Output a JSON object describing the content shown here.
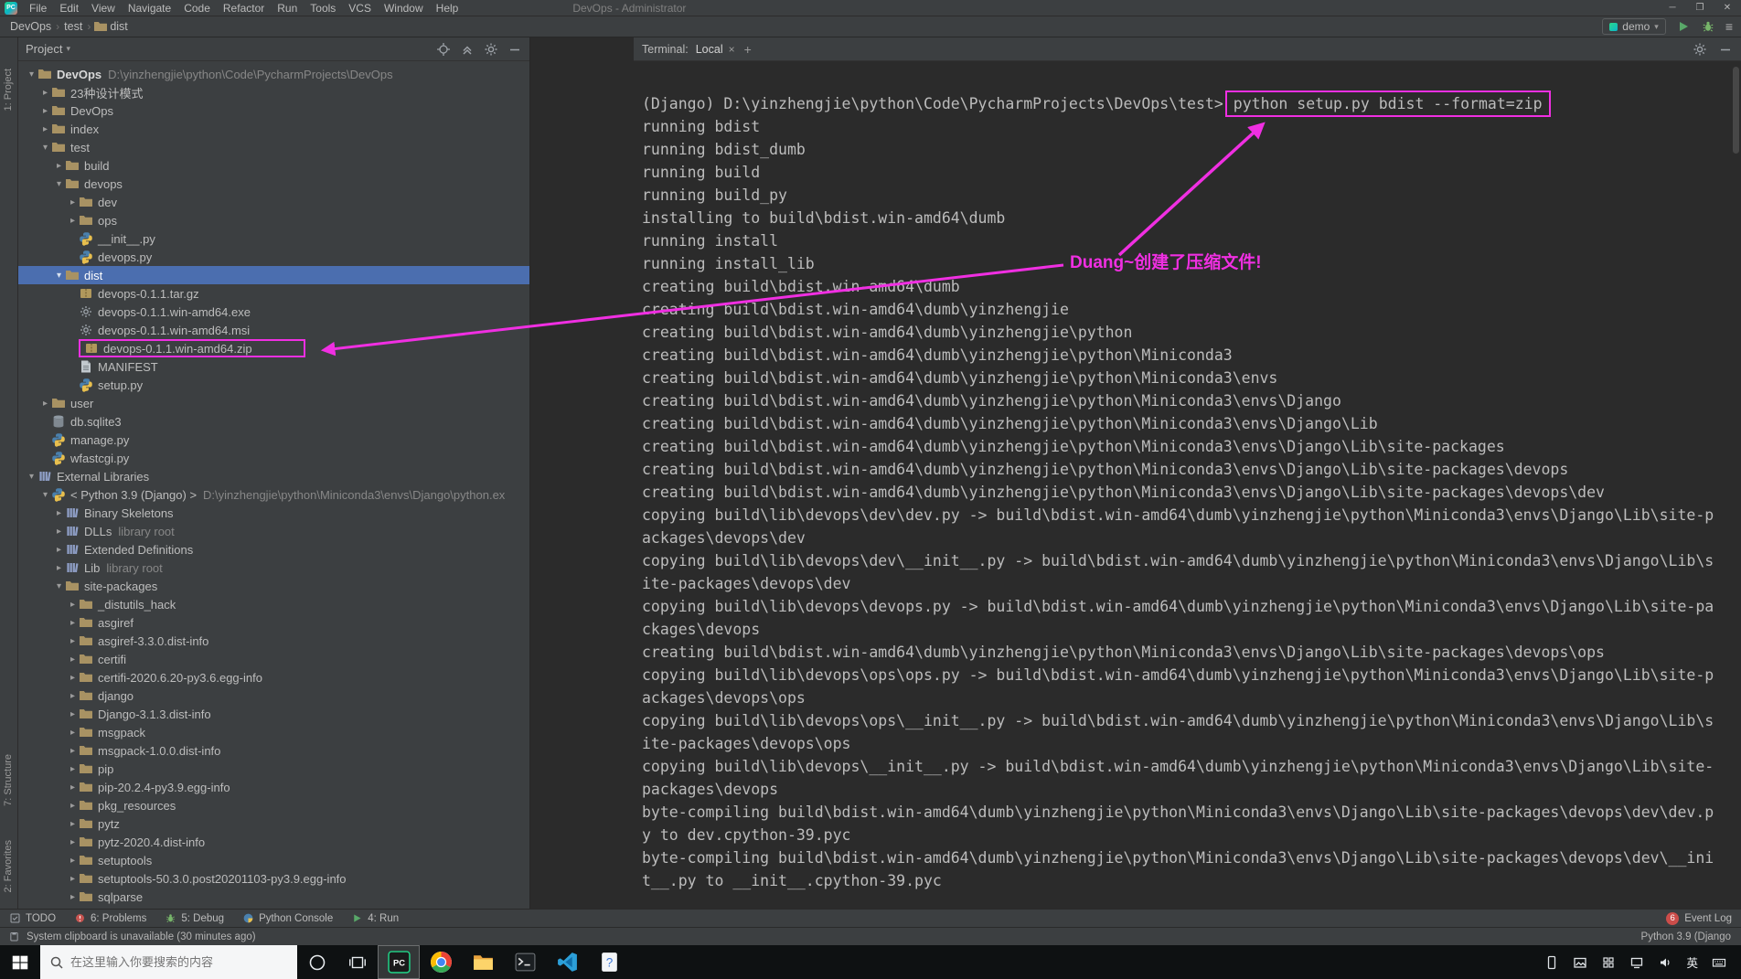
{
  "icons_text": {
    "dropdown": "▾",
    "chevron_open": "▾",
    "chevron_closed": "▸",
    "breadcrumb_sep": "›",
    "tab_close": "×",
    "tab_new": "+",
    "minimize": "─",
    "maximize": "❐",
    "close": "✕",
    "hamburger": "≡",
    "logo_text": "PC"
  },
  "titlebar": {
    "menus": [
      "File",
      "Edit",
      "View",
      "Navigate",
      "Code",
      "Refactor",
      "Run",
      "Tools",
      "VCS",
      "Window",
      "Help"
    ],
    "title": "DevOps - Administrator"
  },
  "navbar": {
    "breadcrumbs": [
      "DevOps",
      "test",
      "dist"
    ],
    "run_config": "demo"
  },
  "tool_strips": {
    "project": "1: Project",
    "structure": "7: Structure",
    "favorites": "2: Favorites"
  },
  "project_panel": {
    "title": "Project",
    "tree": [
      {
        "ind": 0,
        "ch": "v",
        "ic": "folder",
        "lb": "DevOps",
        "sub": "D:\\yinzhengjie\\python\\Code\\PycharmProjects\\DevOps",
        "bold": true
      },
      {
        "ind": 1,
        "ch": ">",
        "ic": "folder",
        "lb": "23种设计模式"
      },
      {
        "ind": 1,
        "ch": ">",
        "ic": "folder",
        "lb": "DevOps"
      },
      {
        "ind": 1,
        "ch": ">",
        "ic": "folder",
        "lb": "index"
      },
      {
        "ind": 1,
        "ch": "v",
        "ic": "folder",
        "lb": "test"
      },
      {
        "ind": 2,
        "ch": ">",
        "ic": "folder",
        "lb": "build"
      },
      {
        "ind": 2,
        "ch": "v",
        "ic": "folder",
        "lb": "devops"
      },
      {
        "ind": 3,
        "ch": ">",
        "ic": "folder",
        "lb": "dev"
      },
      {
        "ind": 3,
        "ch": ">",
        "ic": "folder",
        "lb": "ops"
      },
      {
        "ind": 3,
        "ch": "",
        "ic": "python",
        "lb": "__init__.py"
      },
      {
        "ind": 3,
        "ch": "",
        "ic": "python",
        "lb": "devops.py"
      },
      {
        "ind": 2,
        "ch": "v",
        "ic": "folder",
        "lb": "dist",
        "sel": true
      },
      {
        "ind": 3,
        "ch": "",
        "ic": "archive",
        "lb": "devops-0.1.1.tar.gz"
      },
      {
        "ind": 3,
        "ch": "",
        "ic": "binary",
        "lb": "devops-0.1.1.win-amd64.exe"
      },
      {
        "ind": 3,
        "ch": "",
        "ic": "binary",
        "lb": "devops-0.1.1.win-amd64.msi"
      },
      {
        "ind": 3,
        "ch": "",
        "ic": "archive",
        "lb": "devops-0.1.1.win-amd64.zip",
        "box": true
      },
      {
        "ind": 3,
        "ch": "",
        "ic": "file",
        "lb": "MANIFEST"
      },
      {
        "ind": 3,
        "ch": "",
        "ic": "python",
        "lb": "setup.py"
      },
      {
        "ind": 1,
        "ch": ">",
        "ic": "folder",
        "lb": "user"
      },
      {
        "ind": 1,
        "ch": "",
        "ic": "db",
        "lb": "db.sqlite3"
      },
      {
        "ind": 1,
        "ch": "",
        "ic": "python",
        "lb": "manage.py"
      },
      {
        "ind": 1,
        "ch": "",
        "ic": "python",
        "lb": "wfastcgi.py"
      },
      {
        "ind": 0,
        "ch": "v",
        "ic": "lib",
        "lb": "External Libraries"
      },
      {
        "ind": 1,
        "ch": "v",
        "ic": "python",
        "lb": "< Python 3.9 (Django) >",
        "sub": "D:\\yinzhengjie\\python\\Miniconda3\\envs\\Django\\python.ex"
      },
      {
        "ind": 2,
        "ch": ">",
        "ic": "lib",
        "lb": "Binary Skeletons"
      },
      {
        "ind": 2,
        "ch": ">",
        "ic": "lib",
        "lb": "DLLs",
        "sub": "library root"
      },
      {
        "ind": 2,
        "ch": ">",
        "ic": "lib",
        "lb": "Extended Definitions"
      },
      {
        "ind": 2,
        "ch": ">",
        "ic": "lib",
        "lb": "Lib",
        "sub": "library root"
      },
      {
        "ind": 2,
        "ch": "v",
        "ic": "folder",
        "lb": "site-packages"
      },
      {
        "ind": 3,
        "ch": ">",
        "ic": "folder",
        "lb": "_distutils_hack"
      },
      {
        "ind": 3,
        "ch": ">",
        "ic": "folder",
        "lb": "asgiref"
      },
      {
        "ind": 3,
        "ch": ">",
        "ic": "folder",
        "lb": "asgiref-3.3.0.dist-info"
      },
      {
        "ind": 3,
        "ch": ">",
        "ic": "folder",
        "lb": "certifi"
      },
      {
        "ind": 3,
        "ch": ">",
        "ic": "folder",
        "lb": "certifi-2020.6.20-py3.6.egg-info"
      },
      {
        "ind": 3,
        "ch": ">",
        "ic": "folder",
        "lb": "django"
      },
      {
        "ind": 3,
        "ch": ">",
        "ic": "folder",
        "lb": "Django-3.1.3.dist-info"
      },
      {
        "ind": 3,
        "ch": ">",
        "ic": "folder",
        "lb": "msgpack"
      },
      {
        "ind": 3,
        "ch": ">",
        "ic": "folder",
        "lb": "msgpack-1.0.0.dist-info"
      },
      {
        "ind": 3,
        "ch": ">",
        "ic": "folder",
        "lb": "pip"
      },
      {
        "ind": 3,
        "ch": ">",
        "ic": "folder",
        "lb": "pip-20.2.4-py3.9.egg-info"
      },
      {
        "ind": 3,
        "ch": ">",
        "ic": "folder",
        "lb": "pkg_resources"
      },
      {
        "ind": 3,
        "ch": ">",
        "ic": "folder",
        "lb": "pytz"
      },
      {
        "ind": 3,
        "ch": ">",
        "ic": "folder",
        "lb": "pytz-2020.4.dist-info"
      },
      {
        "ind": 3,
        "ch": ">",
        "ic": "folder",
        "lb": "setuptools"
      },
      {
        "ind": 3,
        "ch": ">",
        "ic": "folder",
        "lb": "setuptools-50.3.0.post20201103-py3.9.egg-info"
      },
      {
        "ind": 3,
        "ch": ">",
        "ic": "folder",
        "lb": "sqlparse"
      }
    ]
  },
  "terminal": {
    "label": "Terminal:",
    "tab": "Local",
    "prompt_prefix": "(Django) D:\\yinzhengjie\\python\\Code\\PycharmProjects\\DevOps\\test>",
    "command": "python setup.py bdist --format=zip",
    "lines": [
      "running bdist",
      "running bdist_dumb",
      "running build",
      "running build_py",
      "installing to build\\bdist.win-amd64\\dumb",
      "running install",
      "running install_lib",
      "creating build\\bdist.win-amd64\\dumb",
      "creating build\\bdist.win-amd64\\dumb\\yinzhengjie",
      "creating build\\bdist.win-amd64\\dumb\\yinzhengjie\\python",
      "creating build\\bdist.win-amd64\\dumb\\yinzhengjie\\python\\Miniconda3",
      "creating build\\bdist.win-amd64\\dumb\\yinzhengjie\\python\\Miniconda3\\envs",
      "creating build\\bdist.win-amd64\\dumb\\yinzhengjie\\python\\Miniconda3\\envs\\Django",
      "creating build\\bdist.win-amd64\\dumb\\yinzhengjie\\python\\Miniconda3\\envs\\Django\\Lib",
      "creating build\\bdist.win-amd64\\dumb\\yinzhengjie\\python\\Miniconda3\\envs\\Django\\Lib\\site-packages",
      "creating build\\bdist.win-amd64\\dumb\\yinzhengjie\\python\\Miniconda3\\envs\\Django\\Lib\\site-packages\\devops",
      "creating build\\bdist.win-amd64\\dumb\\yinzhengjie\\python\\Miniconda3\\envs\\Django\\Lib\\site-packages\\devops\\dev",
      "copying build\\lib\\devops\\dev\\dev.py -> build\\bdist.win-amd64\\dumb\\yinzhengjie\\python\\Miniconda3\\envs\\Django\\Lib\\site-p",
      "ackages\\devops\\dev",
      "copying build\\lib\\devops\\dev\\__init__.py -> build\\bdist.win-amd64\\dumb\\yinzhengjie\\python\\Miniconda3\\envs\\Django\\Lib\\s",
      "ite-packages\\devops\\dev",
      "copying build\\lib\\devops\\devops.py -> build\\bdist.win-amd64\\dumb\\yinzhengjie\\python\\Miniconda3\\envs\\Django\\Lib\\site-pa",
      "ckages\\devops",
      "creating build\\bdist.win-amd64\\dumb\\yinzhengjie\\python\\Miniconda3\\envs\\Django\\Lib\\site-packages\\devops\\ops",
      "copying build\\lib\\devops\\ops\\ops.py -> build\\bdist.win-amd64\\dumb\\yinzhengjie\\python\\Miniconda3\\envs\\Django\\Lib\\site-p",
      "ackages\\devops\\ops",
      "copying build\\lib\\devops\\ops\\__init__.py -> build\\bdist.win-amd64\\dumb\\yinzhengjie\\python\\Miniconda3\\envs\\Django\\Lib\\s",
      "ite-packages\\devops\\ops",
      "copying build\\lib\\devops\\__init__.py -> build\\bdist.win-amd64\\dumb\\yinzhengjie\\python\\Miniconda3\\envs\\Django\\Lib\\site-",
      "packages\\devops",
      "byte-compiling build\\bdist.win-amd64\\dumb\\yinzhengjie\\python\\Miniconda3\\envs\\Django\\Lib\\site-packages\\devops\\dev\\dev.p",
      "y to dev.cpython-39.pyc",
      "byte-compiling build\\bdist.win-amd64\\dumb\\yinzhengjie\\python\\Miniconda3\\envs\\Django\\Lib\\site-packages\\devops\\dev\\__ini",
      "t__.py to __init__.cpython-39.pyc"
    ]
  },
  "annotation": {
    "text": "Duang~创建了压缩文件!"
  },
  "bottom_bar": {
    "items": [
      {
        "label": "TODO",
        "icon": "todo"
      },
      {
        "label": "6: Problems",
        "icon": "problems"
      },
      {
        "label": "5: Debug",
        "icon": "bug"
      },
      {
        "label": "Python Console",
        "icon": "pymini"
      },
      {
        "label": "4: Run",
        "icon": "play"
      }
    ],
    "event_log": {
      "label": "Event Log",
      "badge": "6"
    }
  },
  "status_bar": {
    "message": "System clipboard is unavailable (30 minutes ago)",
    "interpreter": "Python 3.9 (Django"
  },
  "taskbar": {
    "search_placeholder": "在这里输入你要搜索的内容",
    "lang": "英"
  },
  "colors": {
    "accent_magenta": "#f02fe2",
    "selection_blue": "#4b6eaf",
    "panel_bg": "#3c3f41",
    "terminal_bg": "#2b2b2b",
    "taskbar_bg": "#0e1112"
  }
}
